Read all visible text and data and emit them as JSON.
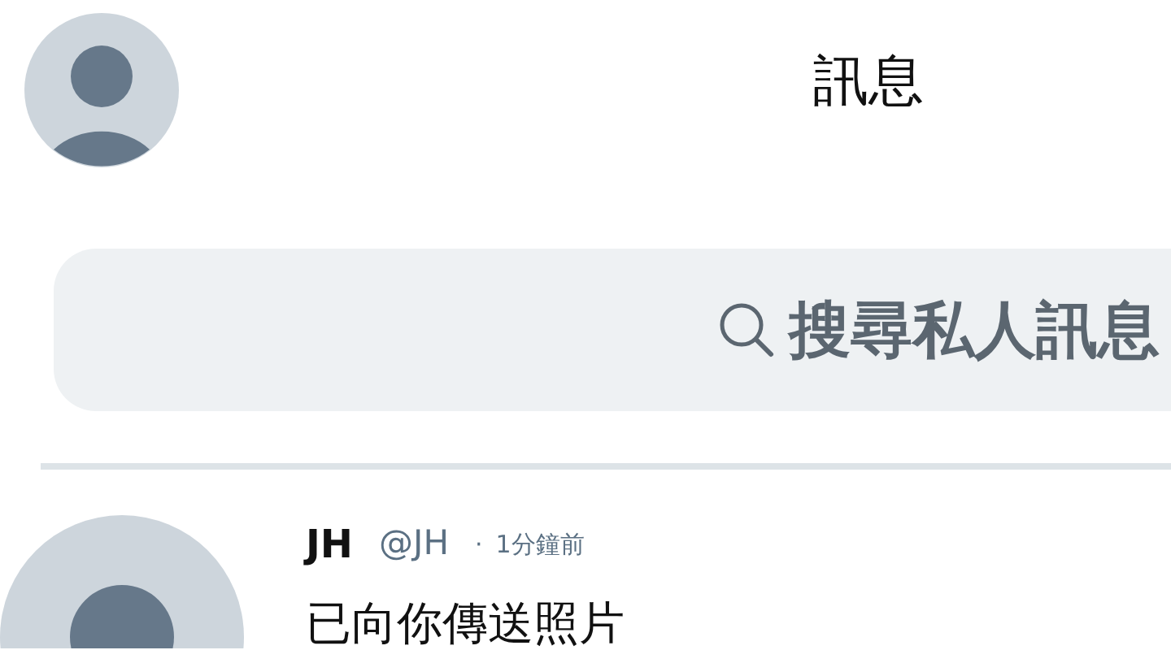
{
  "header": {
    "title": "訊息"
  },
  "search": {
    "placeholder": "搜尋私人訊息"
  },
  "conversations": [
    {
      "name": "JH",
      "handle": "@JH",
      "separator": "·",
      "time": "1分鐘前",
      "preview": "已向你傳送照片"
    }
  ]
}
